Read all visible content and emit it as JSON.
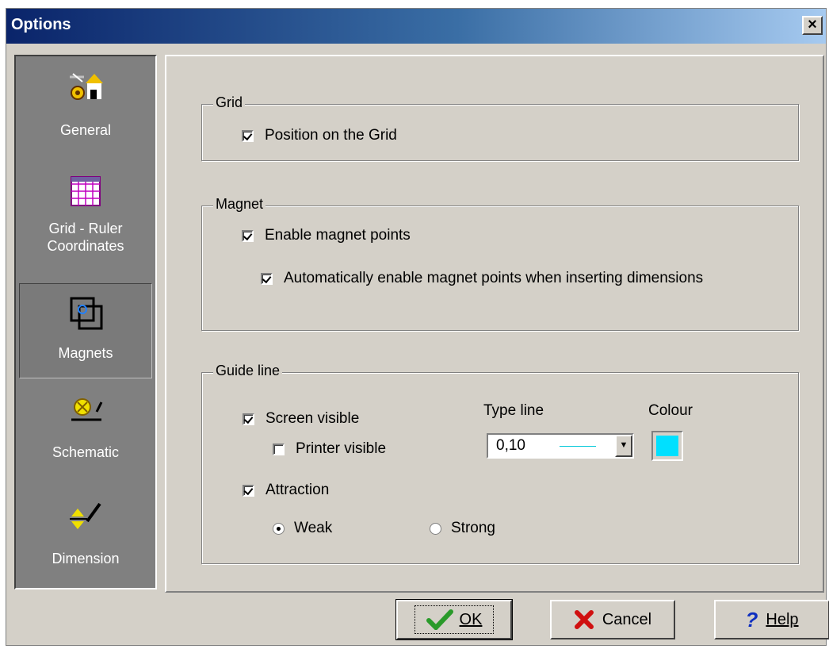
{
  "window": {
    "title": "Options",
    "close_glyph": "×"
  },
  "sidebar": {
    "items": [
      {
        "label": "General",
        "icon": "general-settings-icon",
        "selected": false
      },
      {
        "label": "Grid - Ruler\nCoordinates",
        "icon": "grid-icon",
        "selected": false
      },
      {
        "label": "Magnets",
        "icon": "magnet-icon",
        "selected": true
      },
      {
        "label": "Schematic",
        "icon": "schematic-icon",
        "selected": false
      },
      {
        "label": "Dimension",
        "icon": "dimension-icon",
        "selected": false
      }
    ]
  },
  "grid_group": {
    "legend": "Grid",
    "position_on_grid": {
      "label": "Position on the Grid",
      "checked": true
    }
  },
  "magnet_group": {
    "legend": "Magnet",
    "enable_magnet_points": {
      "label": "Enable magnet points",
      "checked": true
    },
    "auto_enable": {
      "label": "Automatically enable magnet points when inserting dimensions",
      "checked": true
    }
  },
  "guide_group": {
    "legend": "Guide line",
    "screen_visible": {
      "label": "Screen visible",
      "checked": true
    },
    "printer_visible": {
      "label": "Printer visible",
      "checked": false
    },
    "attraction": {
      "label": "Attraction",
      "checked": true
    },
    "weak": {
      "label": "Weak",
      "selected": true
    },
    "strong": {
      "label": "Strong",
      "selected": false
    },
    "type_line_label": "Type line",
    "type_line_value": "0,10",
    "colour_label": "Colour",
    "colour_value": "#00e0ff"
  },
  "buttons": {
    "ok": "OK",
    "cancel": "Cancel",
    "help": "Help"
  }
}
